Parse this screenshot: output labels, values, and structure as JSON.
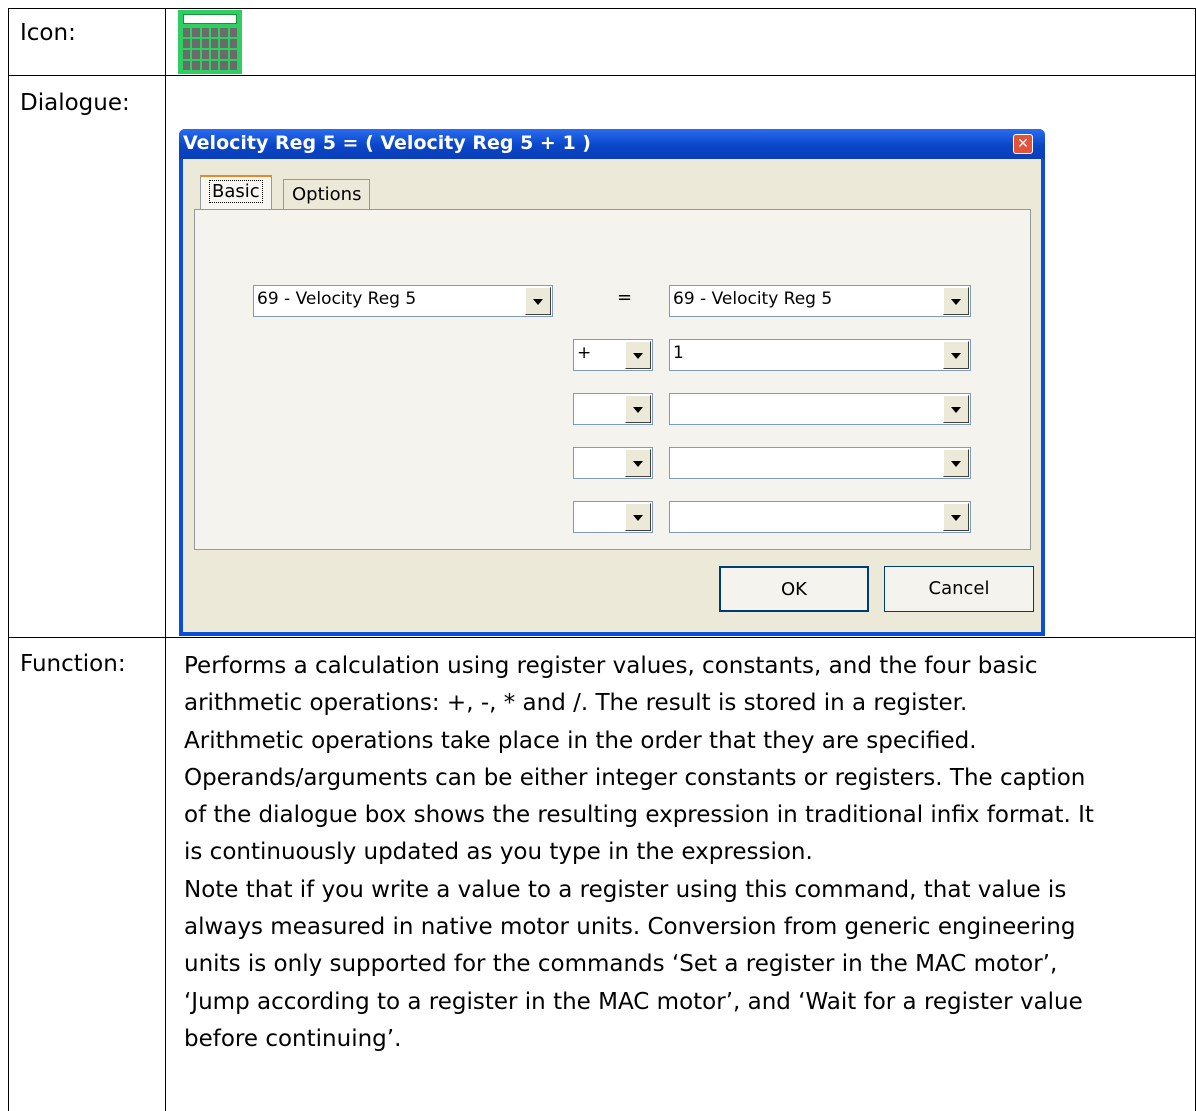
{
  "table": {
    "icon_label": "Icon:",
    "dialogue_label": "Dialogue:",
    "function_label": "Function:"
  },
  "icon": {
    "name": "calculator-icon",
    "color": "#2ecf61"
  },
  "dialog": {
    "title": "Velocity Reg 5 = ( Velocity Reg 5 + 1 )",
    "close_symbol": "✕",
    "tabs": [
      "Basic",
      "Options"
    ],
    "target_register": "69 - Velocity Reg 5",
    "equals_sign": "=",
    "first_operand": "69 - Velocity Reg 5",
    "rows": [
      {
        "operator": "+",
        "operand": "1"
      },
      {
        "operator": "",
        "operand": ""
      },
      {
        "operator": "",
        "operand": ""
      },
      {
        "operator": "",
        "operand": ""
      }
    ],
    "ok_label": "OK",
    "cancel_label": "Cancel"
  },
  "function_text": [
    "Performs a calculation using register values, constants, and the four basic",
    "arithmetic operations: +, -, * and /. The result is stored in a register.",
    "Arithmetic operations take place in the order that they are specified.",
    "Operands/arguments can be either integer constants or registers. The caption",
    "of the dialogue box shows the resulting expression in traditional infix format. It",
    "is continuously updated as you type in the expression.",
    "Note that if you write a value to a register using this command, that value is",
    "always measured in native motor units. Conversion from generic engineering",
    "units is only supported for the commands ‘Set a register in the MAC motor’,",
    "‘Jump according to a register in the MAC motor’, and ‘Wait for a register value",
    "before continuing’."
  ]
}
